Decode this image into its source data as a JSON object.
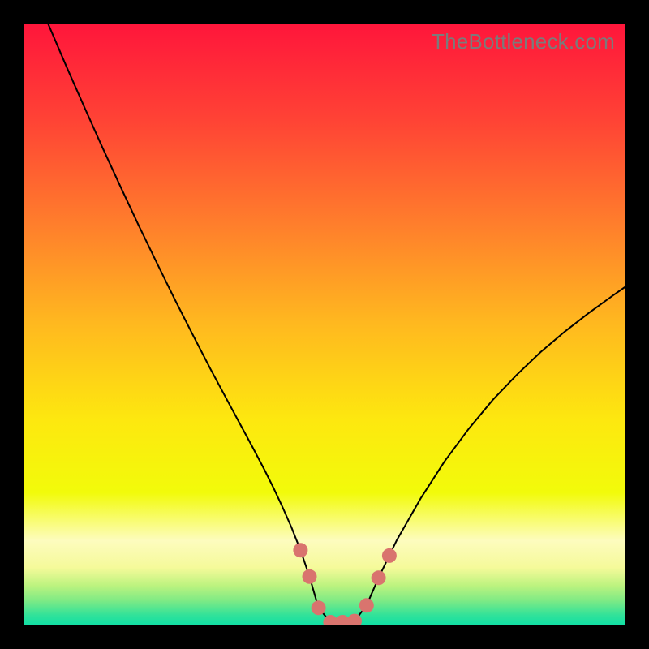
{
  "watermark": "TheBottleneck.com",
  "chart_data": {
    "type": "line",
    "title": "",
    "xlabel": "",
    "ylabel": "",
    "xlim": [
      0,
      1
    ],
    "ylim": [
      0,
      1
    ],
    "grid": false,
    "legend": false,
    "background_gradient": {
      "orientation": "vertical",
      "stops": [
        {
          "offset": 0.0,
          "color": "#ff163b"
        },
        {
          "offset": 0.16,
          "color": "#ff4335"
        },
        {
          "offset": 0.33,
          "color": "#ff7d2c"
        },
        {
          "offset": 0.5,
          "color": "#ffb91f"
        },
        {
          "offset": 0.66,
          "color": "#fde80f"
        },
        {
          "offset": 0.78,
          "color": "#f2fb0a"
        },
        {
          "offset": 0.86,
          "color": "#fdfcbe"
        },
        {
          "offset": 0.905,
          "color": "#f5fa9a"
        },
        {
          "offset": 0.935,
          "color": "#bcf37f"
        },
        {
          "offset": 0.96,
          "color": "#7eea85"
        },
        {
          "offset": 0.985,
          "color": "#2fe29a"
        },
        {
          "offset": 1.0,
          "color": "#12dfa4"
        }
      ]
    },
    "series": [
      {
        "name": "bottleneck-curve",
        "color": "#000000",
        "stroke_width": 2,
        "x": [
          0.04,
          0.07,
          0.1,
          0.13,
          0.16,
          0.19,
          0.22,
          0.25,
          0.28,
          0.31,
          0.34,
          0.36,
          0.38,
          0.4,
          0.415,
          0.43,
          0.445,
          0.46,
          0.475,
          0.49,
          0.51,
          0.53,
          0.55,
          0.57,
          0.59,
          0.62,
          0.66,
          0.7,
          0.74,
          0.78,
          0.82,
          0.86,
          0.9,
          0.94,
          0.98,
          1.0
        ],
        "y": [
          1.0,
          0.93,
          0.862,
          0.795,
          0.73,
          0.666,
          0.604,
          0.543,
          0.484,
          0.426,
          0.37,
          0.333,
          0.296,
          0.258,
          0.228,
          0.196,
          0.162,
          0.124,
          0.08,
          0.028,
          0.004,
          0.004,
          0.006,
          0.032,
          0.078,
          0.14,
          0.21,
          0.272,
          0.326,
          0.374,
          0.416,
          0.454,
          0.488,
          0.519,
          0.548,
          0.562
        ]
      },
      {
        "name": "highlight-markers",
        "type": "scatter",
        "color": "#d9746e",
        "marker_radius": 9,
        "x": [
          0.4,
          0.415,
          0.43,
          0.445,
          0.46,
          0.475,
          0.49,
          0.51,
          0.53,
          0.55,
          0.57,
          0.59,
          0.608
        ],
        "y": [
          0.258,
          0.228,
          0.196,
          0.162,
          0.124,
          0.08,
          0.028,
          0.004,
          0.004,
          0.006,
          0.032,
          0.078,
          0.115
        ],
        "note": "markers visually rendered only where curve dips below ~0.12"
      }
    ]
  }
}
